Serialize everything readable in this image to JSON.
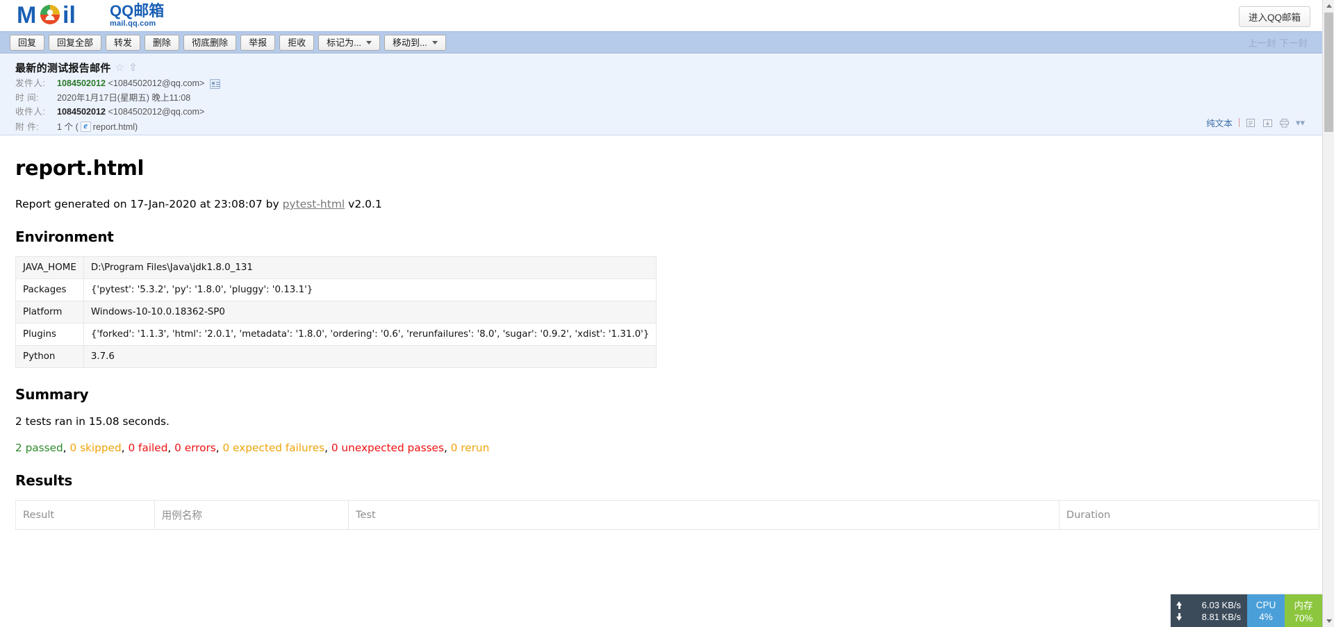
{
  "window": {
    "brand_cn": "QQ邮箱",
    "brand_url": "mail.qq.com",
    "brand_mark": "Mail",
    "enter_button": "进入QQ邮箱"
  },
  "toolbar": {
    "buttons": [
      {
        "label": "回复",
        "dropdown": false
      },
      {
        "label": "回复全部",
        "dropdown": false
      },
      {
        "label": "转发",
        "dropdown": false
      },
      {
        "label": "删除",
        "dropdown": false
      },
      {
        "label": "彻底删除",
        "dropdown": false
      },
      {
        "label": "举报",
        "dropdown": false
      },
      {
        "label": "拒收",
        "dropdown": false
      },
      {
        "label": "标记为...",
        "dropdown": true
      },
      {
        "label": "移动到...",
        "dropdown": true
      }
    ],
    "prev_label": "上一封",
    "next_label": "下一封"
  },
  "mail": {
    "subject": "最新的测试报告邮件",
    "from_label": "发件人:",
    "from_name": "1084502012",
    "from_address": "<1084502012@qq.com>",
    "time_label": "时 间:",
    "time_value": "2020年1月17日(星期五) 晚上11:08",
    "to_label": "收件人:",
    "to_name": "1084502012",
    "to_address": "<1084502012@qq.com>",
    "attach_label": "附 件:",
    "attach_count": "1 个 (",
    "attach_name": "report.html",
    "attach_close": ")",
    "plain_text_link": "纯文本"
  },
  "report": {
    "title": "report.html",
    "generated_prefix": "Report generated on 17-Jan-2020 at 23:08:07 by ",
    "generated_link": "pytest-html",
    "generated_suffix": " v2.0.1",
    "environment_heading": "Environment",
    "environment_rows": [
      {
        "key": "JAVA_HOME",
        "value": "D:\\Program Files\\Java\\jdk1.8.0_131"
      },
      {
        "key": "Packages",
        "value": "{'pytest': '5.3.2', 'py': '1.8.0', 'pluggy': '0.13.1'}"
      },
      {
        "key": "Platform",
        "value": "Windows-10-10.0.18362-SP0"
      },
      {
        "key": "Plugins",
        "value": "{'forked': '1.1.3', 'html': '2.0.1', 'metadata': '1.8.0', 'ordering': '0.6', 'rerunfailures': '8.0', 'sugar': '0.9.2', 'xdist': '1.31.0'}"
      },
      {
        "key": "Python",
        "value": "3.7.6"
      }
    ],
    "summary_heading": "Summary",
    "summary_line": "2 tests ran in 15.08 seconds.",
    "counts": [
      {
        "text": "2 passed",
        "color": "#2d8a2d"
      },
      {
        "text": "0 skipped",
        "color": "#f0a30a"
      },
      {
        "text": "0 failed",
        "color": "#ee1111"
      },
      {
        "text": "0 errors",
        "color": "#ee1111"
      },
      {
        "text": "0 expected failures",
        "color": "#f0a30a"
      },
      {
        "text": "0 unexpected passes",
        "color": "#ee1111"
      },
      {
        "text": "0 rerun",
        "color": "#f0a30a"
      }
    ],
    "results_heading": "Results",
    "results_columns": [
      "Result",
      "用例名称",
      "Test",
      "Duration"
    ]
  },
  "perf": {
    "upload": "6.03 KB/s",
    "download": "8.81 KB/s",
    "cpu_label": "CPU",
    "cpu_value": "4%",
    "mem_label": "内存",
    "mem_value": "70%",
    "cpu_color": "#4a9fd8",
    "mem_color": "#8cc63e"
  }
}
